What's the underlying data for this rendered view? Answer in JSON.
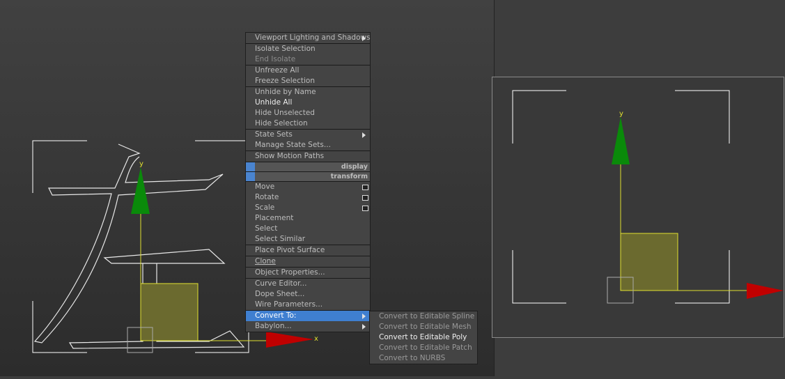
{
  "viewport_left": {
    "axis_y_label": "y",
    "axis_x_label": "x"
  },
  "viewport_right": {
    "axis_y_label": "y"
  },
  "quad_menu": {
    "lighting": "Viewport Lighting and Shadows",
    "isolate_selection": "Isolate Selection",
    "end_isolate": "End Isolate",
    "unfreeze_all": "Unfreeze All",
    "freeze_selection": "Freeze Selection",
    "unhide_by_name": "Unhide by Name",
    "unhide_all": "Unhide All",
    "hide_unselected": "Hide Unselected",
    "hide_selection": "Hide Selection",
    "state_sets": "State Sets",
    "manage_state_sets": "Manage State Sets...",
    "show_motion_paths": "Show Motion Paths",
    "display_label": "display",
    "transform_label": "transform",
    "move": "Move",
    "rotate": "Rotate",
    "scale": "Scale",
    "placement": "Placement",
    "select": "Select",
    "select_similar": "Select Similar",
    "place_pivot_surface": "Place Pivot Surface",
    "clone": "Clone",
    "object_properties": "Object Properties...",
    "curve_editor": "Curve Editor...",
    "dope_sheet": "Dope Sheet...",
    "wire_parameters": "Wire Parameters...",
    "convert_to": "Convert To:",
    "babylon": "Babylon..."
  },
  "convert_submenu": {
    "spline": "Convert to Editable Spline",
    "mesh": "Convert to Editable Mesh",
    "poly": "Convert to Editable Poly",
    "patch": "Convert to Editable Patch",
    "nurbs": "Convert to NURBS"
  },
  "colors": {
    "menu_bg": "#444444",
    "highlight": "#3f7fd0",
    "axis_x": "#cc0000",
    "axis_y": "#008800",
    "gizmo": "#e0e030"
  }
}
